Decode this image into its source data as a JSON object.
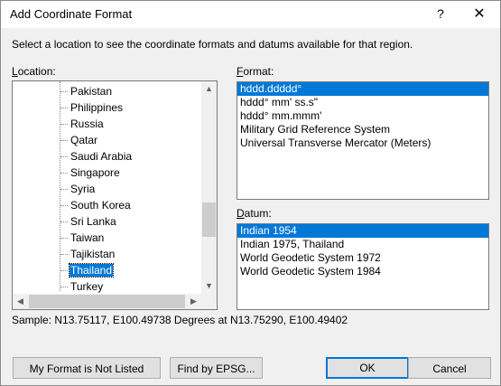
{
  "window": {
    "title": "Add Coordinate Format",
    "help_label": "?",
    "close_label": "✕"
  },
  "instructions": "Select a location to see the coordinate formats and datums available for that region.",
  "location": {
    "label": "Location:",
    "items": [
      "Pakistan",
      "Philippines",
      "Russia",
      "Qatar",
      "Saudi Arabia",
      "Singapore",
      "Syria",
      "South Korea",
      "Sri Lanka",
      "Taiwan",
      "Tajikistan",
      "Thailand",
      "Turkey"
    ],
    "selected": "Thailand"
  },
  "format": {
    "label": "Format:",
    "items": [
      "hddd.ddddd°",
      "hddd° mm' ss.s\"",
      "hddd° mm.mmm'",
      "Military Grid Reference System",
      "Universal Transverse Mercator (Meters)"
    ],
    "selected": "hddd.ddddd°"
  },
  "datum": {
    "label": "Datum:",
    "items": [
      "Indian 1954",
      "Indian 1975, Thailand",
      "World Geodetic System 1972",
      "World Geodetic System 1984"
    ],
    "selected": "Indian 1954"
  },
  "sample_text": "Sample: N13.75117, E100.49738 Degrees at N13.75290, E100.49402",
  "buttons": {
    "not_listed": "My Format is Not Listed",
    "find_epsg": "Find by EPSG...",
    "ok": "OK",
    "cancel": "Cancel"
  },
  "icons": {
    "scroll_up": "scroll-up-arrow-icon",
    "scroll_down": "scroll-down-arrow-icon",
    "scroll_left": "scroll-left-arrow-icon",
    "scroll_right": "scroll-right-arrow-icon"
  },
  "colors": {
    "selection": "#0078d7",
    "dialog_bg": "#f0f0f0",
    "default_button_border": "#0078d7"
  }
}
